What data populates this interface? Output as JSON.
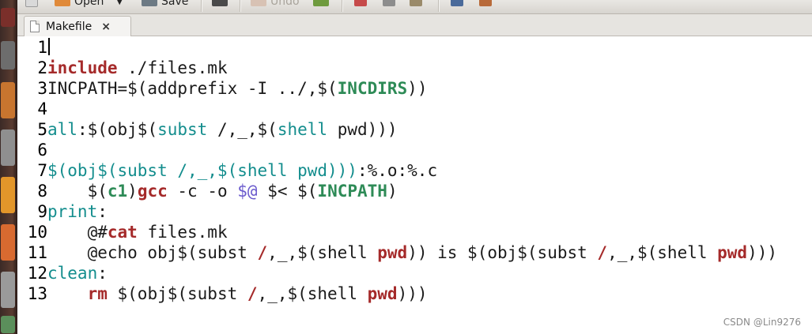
{
  "toolbar": {
    "open_label": "Open",
    "save_label": "Save",
    "undo_label": "Undo"
  },
  "tab": {
    "title": "Makefile",
    "close": "×"
  },
  "lines": [
    {
      "n": "1"
    },
    {
      "n": "2",
      "t": [
        "include",
        " ./files.mk"
      ]
    },
    {
      "n": "3",
      "t": [
        "INCPATH=$(addprefix -I ../,$(",
        "INCDIRS",
        "))"
      ]
    },
    {
      "n": "4"
    },
    {
      "n": "5",
      "t": [
        "all",
        ":$(obj$(",
        "subst",
        " /,_,$(",
        "shell",
        " pwd)))"
      ]
    },
    {
      "n": "6"
    },
    {
      "n": "7",
      "t": [
        "$(obj$(subst /,_,$(shell pwd)))",
        ":%.o:%.c"
      ]
    },
    {
      "n": "8",
      "t": [
        "    $(",
        "c1",
        ")",
        "gcc",
        " -c -o ",
        "$@",
        " $< $(",
        "INCPATH",
        ")"
      ]
    },
    {
      "n": "9",
      "t": [
        "print",
        ":"
      ]
    },
    {
      "n": "10",
      "t": [
        "    @#",
        "cat",
        " files.mk"
      ]
    },
    {
      "n": "11",
      "t": [
        "    @echo obj$(subst ",
        "/",
        ",_,$(shell ",
        "pwd",
        ")) is $(obj$(subst ",
        "/",
        ",_,$(shell ",
        "pwd",
        ")))"
      ]
    },
    {
      "n": "12",
      "t": [
        "clean",
        ":"
      ]
    },
    {
      "n": "13",
      "t": [
        "    ",
        "rm",
        " $(obj$(subst ",
        "/",
        ",_,$(shell ",
        "pwd",
        ")))"
      ]
    }
  ],
  "watermark": "CSDN @Lin9276",
  "colors": {
    "keyword": "#a52a2a",
    "target": "#138d8d",
    "variable": "#2e8b57",
    "autovar": "#6a5acd"
  }
}
